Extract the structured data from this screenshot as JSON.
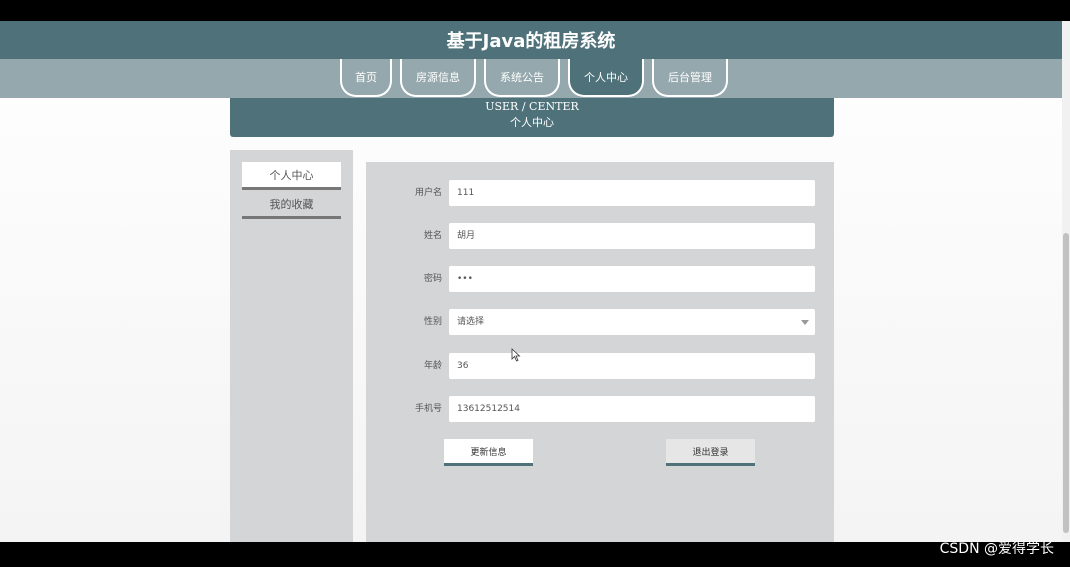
{
  "site": {
    "title": "基于Java的租房系统"
  },
  "nav": {
    "items": [
      {
        "label": "首页"
      },
      {
        "label": "房源信息"
      },
      {
        "label": "系统公告"
      },
      {
        "label": "个人中心"
      },
      {
        "label": "后台管理"
      }
    ],
    "active": "个人中心"
  },
  "banner": {
    "en": "USER / CENTER",
    "cn": "个人中心"
  },
  "sidebar": {
    "items": [
      {
        "label": "个人中心"
      },
      {
        "label": "我的收藏"
      }
    ]
  },
  "form": {
    "username": {
      "label": "用户名",
      "value": "111"
    },
    "name": {
      "label": "姓名",
      "value": "胡月"
    },
    "password": {
      "label": "密码",
      "value": "•••"
    },
    "gender": {
      "label": "性别",
      "placeholder": "请选择"
    },
    "age": {
      "label": "年龄",
      "value": "36"
    },
    "phone": {
      "label": "手机号",
      "value": "13612512514"
    }
  },
  "buttons": {
    "update": "更新信息",
    "logout": "退出登录"
  },
  "watermark": "CSDN @爱得学长",
  "colors": {
    "primary": "#4f727a",
    "nav_bg": "#95a8ad",
    "panel_bg": "#d3d5d6"
  }
}
